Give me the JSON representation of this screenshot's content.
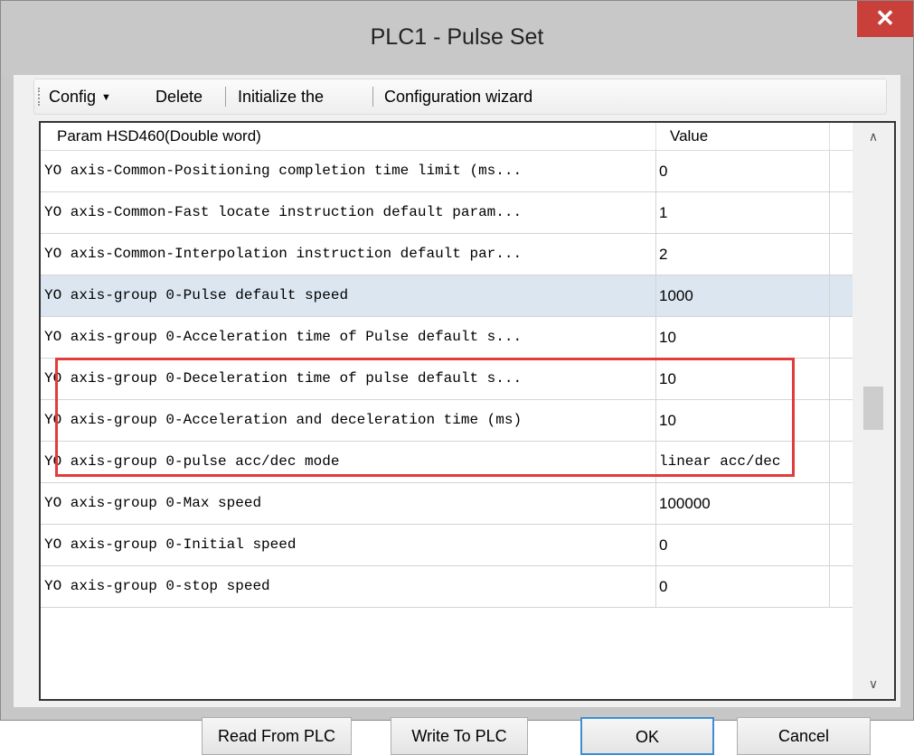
{
  "window": {
    "title": "PLC1 - Pulse  Set",
    "close_glyph": "✕"
  },
  "toolbar": {
    "config_label": "Config",
    "delete_label": "Delete",
    "initialize_label": "Initialize the",
    "wizard_label": "Configuration wizard"
  },
  "grid": {
    "header": {
      "param": "Param HSD460(Double word)",
      "value": "Value"
    },
    "rows": [
      {
        "name": "YO axis-Common-Positioning completion time limit (ms...",
        "value": "0"
      },
      {
        "name": "YO axis-Common-Fast locate instruction default param...",
        "value": "1"
      },
      {
        "name": "YO axis-Common-Interpolation instruction default par...",
        "value": "2"
      },
      {
        "name": "YO axis-group 0-Pulse default speed",
        "value": "1000"
      },
      {
        "name": "YO axis-group 0-Acceleration time of Pulse default s...",
        "value": "10"
      },
      {
        "name": "YO axis-group 0-Deceleration time of pulse default s...",
        "value": "10"
      },
      {
        "name": "YO axis-group 0-Acceleration and deceleration time (ms)",
        "value": "10"
      },
      {
        "name": "YO axis-group 0-pulse acc/dec mode",
        "value": "linear acc/dec"
      },
      {
        "name": "YO axis-group 0-Max speed",
        "value": "100000"
      },
      {
        "name": "YO axis-group 0-Initial speed",
        "value": "0"
      },
      {
        "name": "YO axis-group 0-stop speed",
        "value": "0"
      }
    ],
    "selected_row": 3
  },
  "buttons": {
    "read": "Read From PLC",
    "write": "Write To PLC",
    "ok": "OK",
    "cancel": "Cancel"
  },
  "colors": {
    "highlight_box": "#e23b3b",
    "selected_row": "#dce6f1",
    "close_button": "#c9403b"
  }
}
